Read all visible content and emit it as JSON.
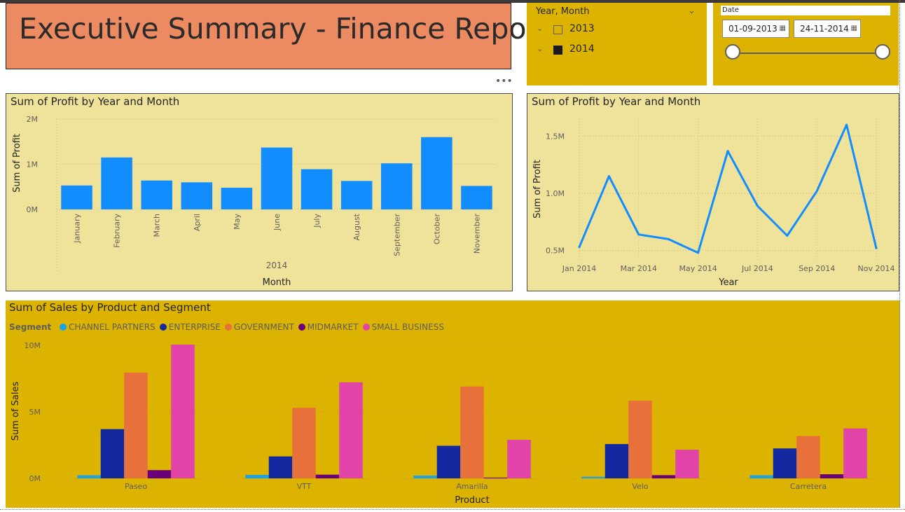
{
  "report": {
    "title": "Executive Summary - Finance Report",
    "more_options": "•••"
  },
  "slicer_year_month": {
    "header": "Year, Month",
    "items": [
      {
        "label": "2013",
        "checked": false
      },
      {
        "label": "2014",
        "checked": true
      }
    ]
  },
  "slicer_date": {
    "header": "Date",
    "start": "01-09-2013",
    "end": "24-11-2014",
    "start_fraction": 0.0,
    "end_fraction": 1.0
  },
  "colors": {
    "accent_blue": "#118dff",
    "panel_yellow": "#efe29a",
    "slicer_gold": "#dbb300",
    "title_bg": "#ec8a62"
  },
  "chart_data": [
    {
      "id": "bar",
      "type": "bar",
      "title": "Sum of Profit by Year and Month",
      "xlabel": "Month",
      "ylabel": "Sum of Profit",
      "group_label": "2014",
      "categories": [
        "January",
        "February",
        "March",
        "April",
        "May",
        "June",
        "July",
        "August",
        "September",
        "October",
        "November"
      ],
      "values": [
        0.53,
        1.15,
        0.64,
        0.6,
        0.48,
        1.37,
        0.89,
        0.63,
        1.02,
        1.6,
        0.52
      ],
      "value_unit": "M",
      "ylim": [
        0,
        2
      ],
      "yticks": [
        "0M",
        "1M",
        "2M"
      ],
      "color": "#118dff",
      "grid": true
    },
    {
      "id": "line",
      "type": "line",
      "title": "Sum of Profit by Year and Month",
      "xlabel": "Year",
      "ylabel": "Sum of Profit",
      "x": [
        "Jan 2014",
        "Feb 2014",
        "Mar 2014",
        "Apr 2014",
        "May 2014",
        "Jun 2014",
        "Jul 2014",
        "Aug 2014",
        "Sep 2014",
        "Oct 2014",
        "Nov 2014"
      ],
      "xtick_labels": [
        "Jan 2014",
        "Mar 2014",
        "May 2014",
        "Jul 2014",
        "Sep 2014",
        "Nov 2014"
      ],
      "values": [
        0.53,
        1.15,
        0.64,
        0.6,
        0.48,
        1.37,
        0.89,
        0.63,
        1.02,
        1.6,
        0.52
      ],
      "value_unit": "M",
      "ylim": [
        0.4,
        1.65
      ],
      "yticks": [
        "0.5M",
        "1.0M",
        "1.5M"
      ],
      "color": "#118dff",
      "grid": true
    },
    {
      "id": "grouped",
      "type": "bar",
      "title": "Sum of Sales by Product and Segment",
      "xlabel": "Product",
      "ylabel": "Sum of Sales",
      "legend_title": "Segment",
      "legend_position": "top-left",
      "categories": [
        "Paseo",
        "VTT",
        "Amarilla",
        "Velo",
        "Carretera"
      ],
      "series": [
        {
          "name": "CHANNEL PARTNERS",
          "color": "#1aa3e6",
          "values": [
            0.23,
            0.26,
            0.21,
            0.12,
            0.23
          ]
        },
        {
          "name": "ENTERPRISE",
          "color": "#1428a0",
          "values": [
            3.7,
            1.65,
            2.45,
            2.58,
            2.25
          ]
        },
        {
          "name": "GOVERNMENT",
          "color": "#e8703a",
          "values": [
            7.95,
            5.3,
            6.9,
            5.83,
            3.18
          ]
        },
        {
          "name": "MIDMARKET",
          "color": "#6b007b",
          "values": [
            0.62,
            0.28,
            0.06,
            0.24,
            0.31
          ]
        },
        {
          "name": "SMALL BUSINESS",
          "color": "#e044a7",
          "values": [
            10.05,
            7.22,
            2.9,
            2.15,
            3.75
          ]
        }
      ],
      "value_unit": "M",
      "ylim": [
        0,
        10.05
      ],
      "yticks": [
        "0M",
        "5M",
        "10M"
      ],
      "grid": true
    }
  ]
}
